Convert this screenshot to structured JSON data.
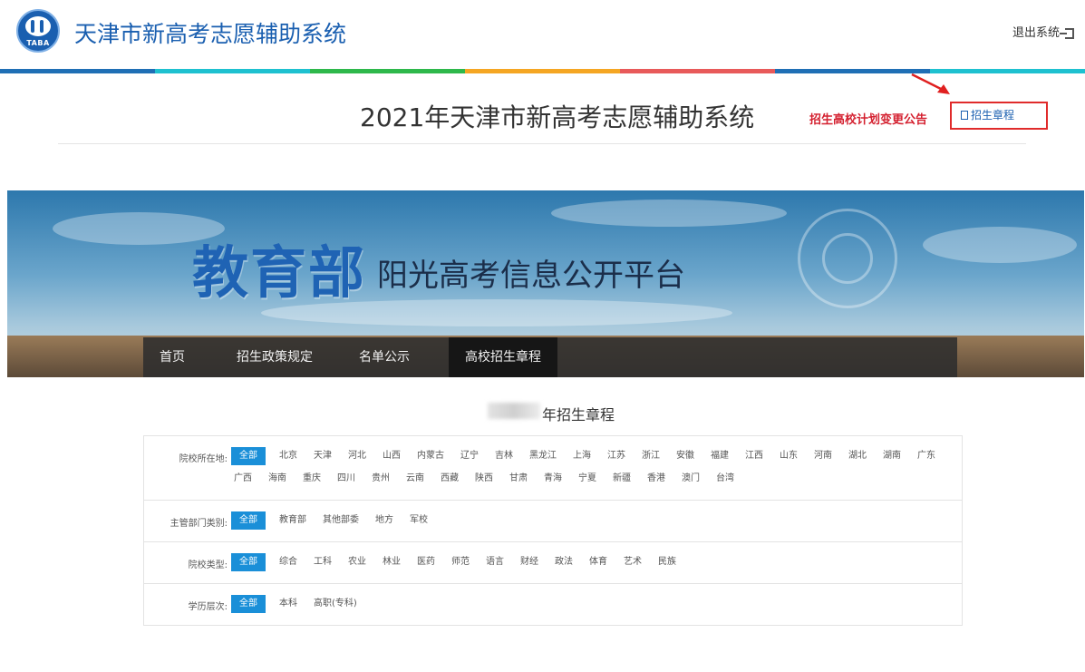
{
  "header": {
    "logo_text": "TABA",
    "app_title": "天津市新高考志愿辅助系统",
    "logout_label": "退出系统"
  },
  "color_bar": [
    "#1f6fb5",
    "#1ec1d0",
    "#2eb84b",
    "#f5a623",
    "#e85a5a",
    "#1f6fb5",
    "#1ec1d0"
  ],
  "page": {
    "title": "2021年天津市新高考志愿辅助系统",
    "notice_link": "招生高校计划变更公告",
    "charter_button": "招生章程"
  },
  "embedded": {
    "banner_main": "教育部",
    "banner_sub": "阳光高考信息公开平台",
    "nav": [
      "首页",
      "招生政策规定",
      "名单公示",
      "高校招生章程"
    ],
    "nav_active_index": 3,
    "charter_title": "年招生章程",
    "filters": [
      {
        "label": "院校所在地:",
        "options": [
          "全部",
          "北京",
          "天津",
          "河北",
          "山西",
          "内蒙古",
          "辽宁",
          "吉林",
          "黑龙江",
          "上海",
          "江苏",
          "浙江",
          "安徽",
          "福建",
          "江西",
          "山东",
          "河南",
          "湖北",
          "湖南",
          "广东",
          "广西",
          "海南",
          "重庆",
          "四川",
          "贵州",
          "云南",
          "西藏",
          "陕西",
          "甘肃",
          "青海",
          "宁夏",
          "新疆",
          "香港",
          "澳门",
          "台湾"
        ]
      },
      {
        "label": "主管部门类别:",
        "options": [
          "全部",
          "教育部",
          "其他部委",
          "地方",
          "军校"
        ]
      },
      {
        "label": "院校类型:",
        "options": [
          "全部",
          "综合",
          "工科",
          "农业",
          "林业",
          "医药",
          "师范",
          "语言",
          "财经",
          "政法",
          "体育",
          "艺术",
          "民族"
        ]
      },
      {
        "label": "学历层次:",
        "options": [
          "全部",
          "本科",
          "高职(专科)"
        ]
      }
    ]
  }
}
